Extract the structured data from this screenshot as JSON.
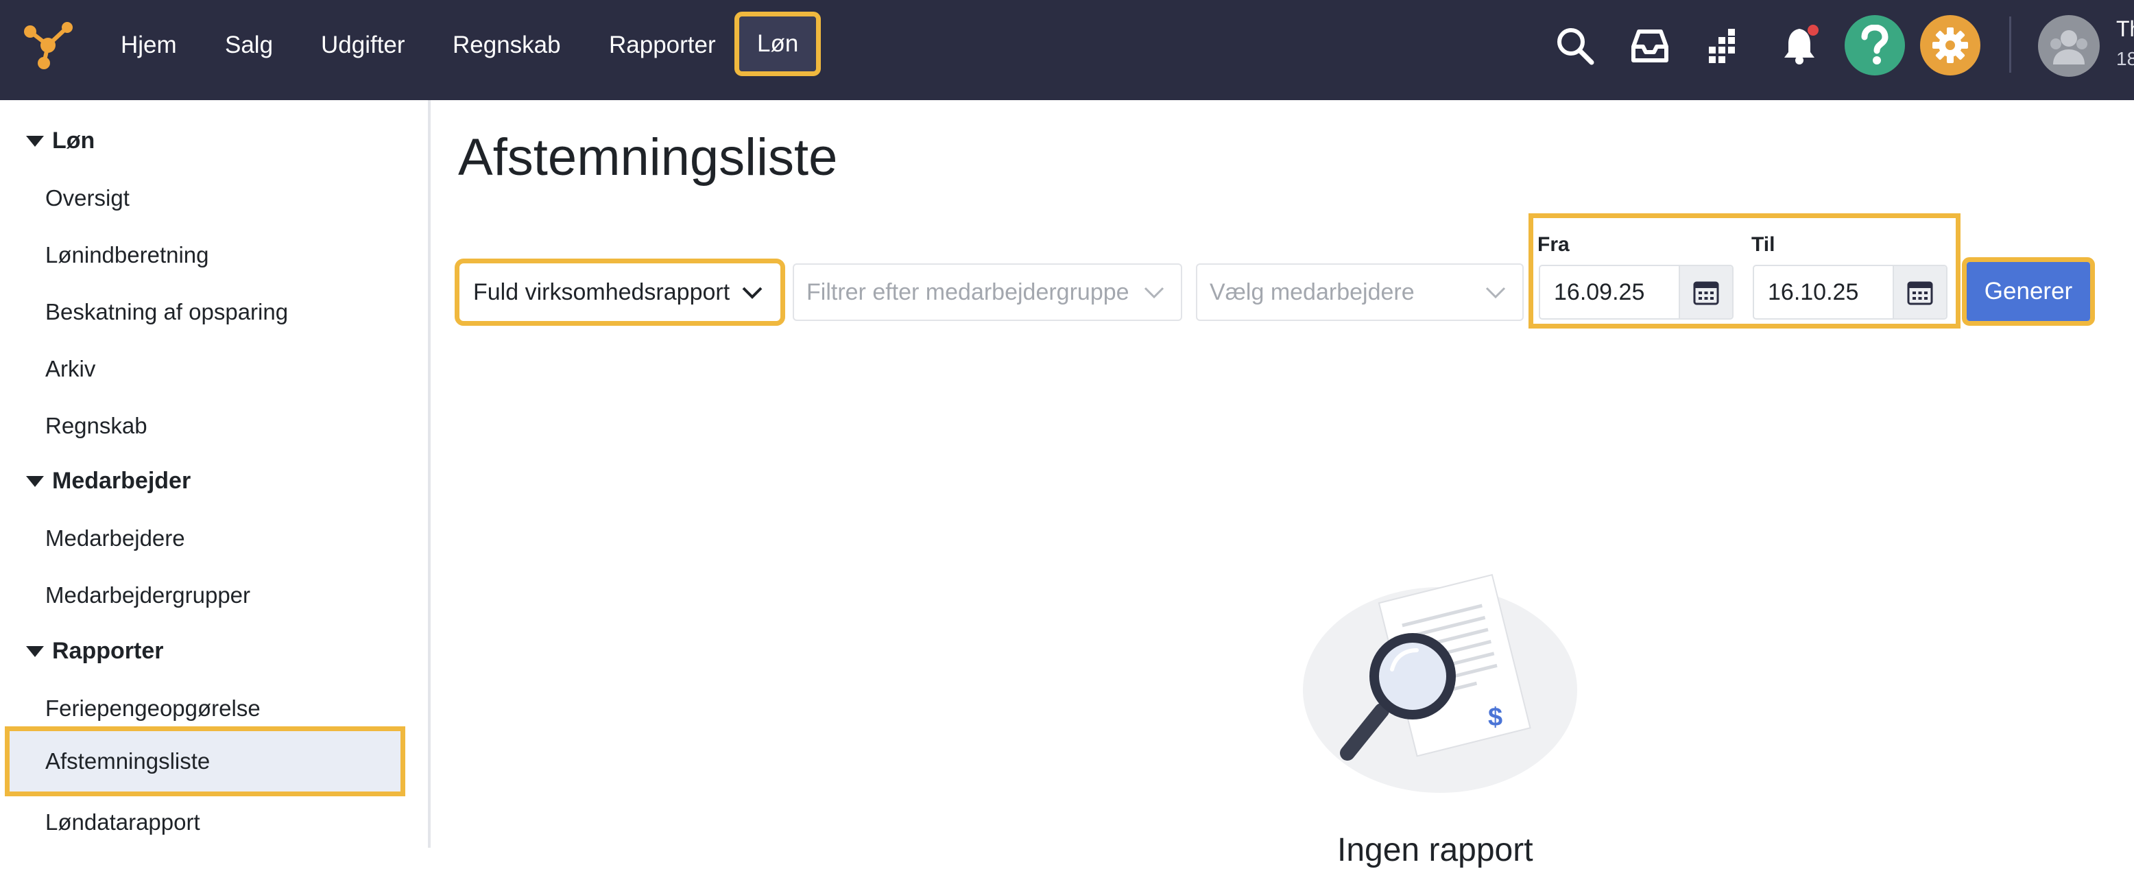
{
  "nav": {
    "items": [
      "Hjem",
      "Salg",
      "Udgifter",
      "Regnskab",
      "Rapporter",
      "Løn"
    ],
    "active": "Løn"
  },
  "icons": {
    "search": "search-icon",
    "inbox": "inbox-icon",
    "apps": "apps-grid-icon",
    "notifications": "bell-icon",
    "help": "help-icon",
    "settings": "gear-icon"
  },
  "user": {
    "name": "Th",
    "sub": "18"
  },
  "colors": {
    "topbar": "#2b2d42",
    "highlight": "#f0b83e",
    "primary": "#4a74d6",
    "help": "#3aa882",
    "settings": "#e8a23c",
    "notification_dot": "#e04646"
  },
  "sidebar": {
    "sections": [
      {
        "label": "Løn",
        "items": [
          "Oversigt",
          "Lønindberetning",
          "Beskatning af opsparing",
          "Arkiv",
          "Regnskab"
        ]
      },
      {
        "label": "Medarbejder",
        "items": [
          "Medarbejdere",
          "Medarbejdergrupper"
        ]
      },
      {
        "label": "Rapporter",
        "items": [
          "Feriepengeopgørelse",
          "Afstemningsliste",
          "Løndatarapport"
        ]
      }
    ],
    "active_item": "Afstemningsliste"
  },
  "page": {
    "title": "Afstemningsliste"
  },
  "filters": {
    "report_type": "Fuld virksomhedsrapport",
    "group_placeholder": "Filtrer efter medarbejdergruppe",
    "employee_placeholder": "Vælg medarbejdere",
    "from_label": "Fra",
    "from_value": "16.09.25",
    "to_label": "Til",
    "to_value": "16.10.25",
    "generate_label": "Generer"
  },
  "empty_state": {
    "text": "Ingen rapport"
  }
}
